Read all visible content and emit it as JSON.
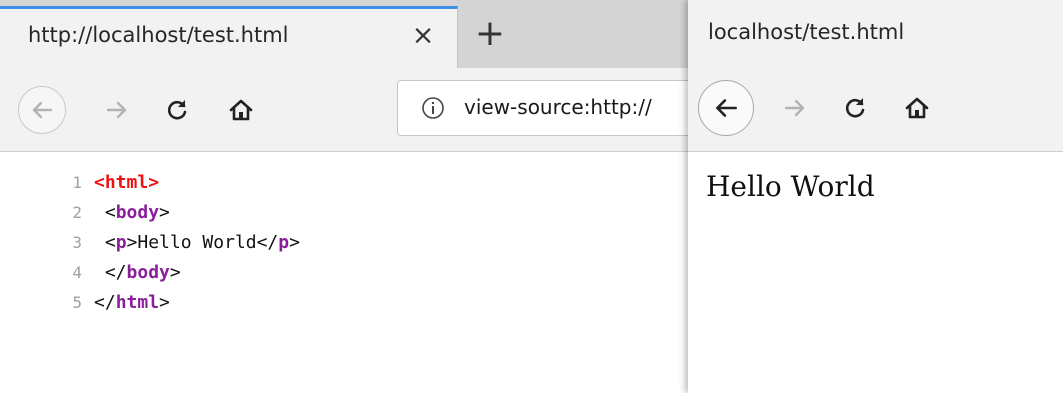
{
  "window_left": {
    "tab": {
      "title": "http://localhost/test.html",
      "close_glyph": "×"
    },
    "new_tab_glyph": "+",
    "toolbar": {
      "back_icon": "back-arrow-icon",
      "forward_icon": "forward-arrow-icon",
      "reload_icon": "reload-icon",
      "home_icon": "home-icon"
    },
    "urlbar": {
      "info_glyph": "i",
      "url": "view-source:http://"
    },
    "source_lines": [
      {
        "num": "1",
        "open": "<",
        "tag": "html",
        "close": ">",
        "text": "",
        "end_open": "",
        "end_tag": "",
        "end_close": "",
        "indent": "",
        "color": "red"
      },
      {
        "num": "2",
        "open": "<",
        "tag": "body",
        "close": ">",
        "text": "",
        "end_open": "",
        "end_tag": "",
        "end_close": "",
        "indent": " ",
        "color": "purple"
      },
      {
        "num": "3",
        "open": "<",
        "tag": "p",
        "close": ">",
        "text": "Hello World",
        "end_open": "</",
        "end_tag": "p",
        "end_close": ">",
        "indent": " ",
        "color": "purple"
      },
      {
        "num": "4",
        "open": "</",
        "tag": "body",
        "close": ">",
        "text": "",
        "end_open": "",
        "end_tag": "",
        "end_close": "",
        "indent": " ",
        "color": "purple"
      },
      {
        "num": "5",
        "open": "</",
        "tag": "html",
        "close": ">",
        "text": "",
        "end_open": "",
        "end_tag": "",
        "end_close": "",
        "indent": "",
        "color": "purple"
      }
    ]
  },
  "window_right": {
    "tab": {
      "title": "localhost/test.html"
    },
    "toolbar": {
      "back_icon": "back-arrow-icon",
      "forward_icon": "forward-arrow-icon",
      "reload_icon": "reload-icon",
      "home_icon": "home-icon"
    },
    "page": {
      "text": "Hello World"
    }
  },
  "colors": {
    "accent_tab": "#3d8ee6",
    "tag_html": "#ee1111",
    "tag_other": "#8a1e9b",
    "desktop": "#0e5a8a"
  }
}
